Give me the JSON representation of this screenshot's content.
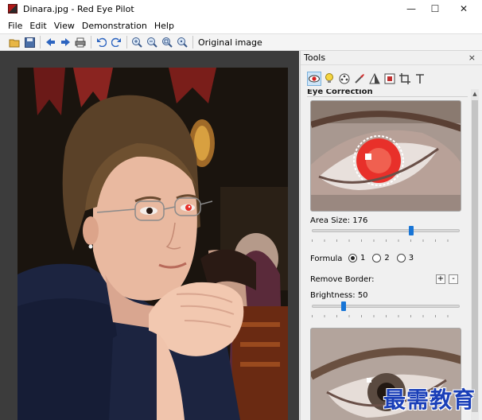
{
  "window": {
    "title": "Dinara.jpg - Red Eye Pilot",
    "controls": {
      "minimize": "—",
      "maximize": "☐",
      "close": "✕"
    }
  },
  "menu": [
    "File",
    "Edit",
    "View",
    "Demonstration",
    "Help"
  ],
  "toolbar": {
    "icons": [
      "open-folder-icon",
      "save-icon",
      "back-arrow-icon",
      "forward-arrow-icon",
      "print-icon",
      "undo-icon",
      "redo-icon",
      "zoom-in-icon",
      "zoom-out-icon",
      "zoom-fit-icon",
      "zoom-actual-icon"
    ],
    "original_label": "Original image"
  },
  "tools": {
    "title": "Tools",
    "close": "×",
    "tool_icons": [
      "eye-icon",
      "bulb-icon",
      "film-icon",
      "brush-icon",
      "contrast-icon",
      "frame-icon",
      "crop-icon",
      "text-icon"
    ],
    "section_title": "Eye Correction",
    "area_size_label": "Area Size: 176",
    "area_size_fraction": 0.68,
    "formula": {
      "label": "Formula",
      "options": [
        "1",
        "2",
        "3"
      ],
      "selected": "1"
    },
    "remove_border": {
      "label": "Remove Border:",
      "plus": "+",
      "minus": "-"
    },
    "brightness_label": "Brightness: 50",
    "brightness_fraction": 0.2
  },
  "watermark": "最需教育",
  "colors": {
    "accent": "#1875d6",
    "red_eye": "#e8302a",
    "watermark": "#1a3fb8"
  }
}
